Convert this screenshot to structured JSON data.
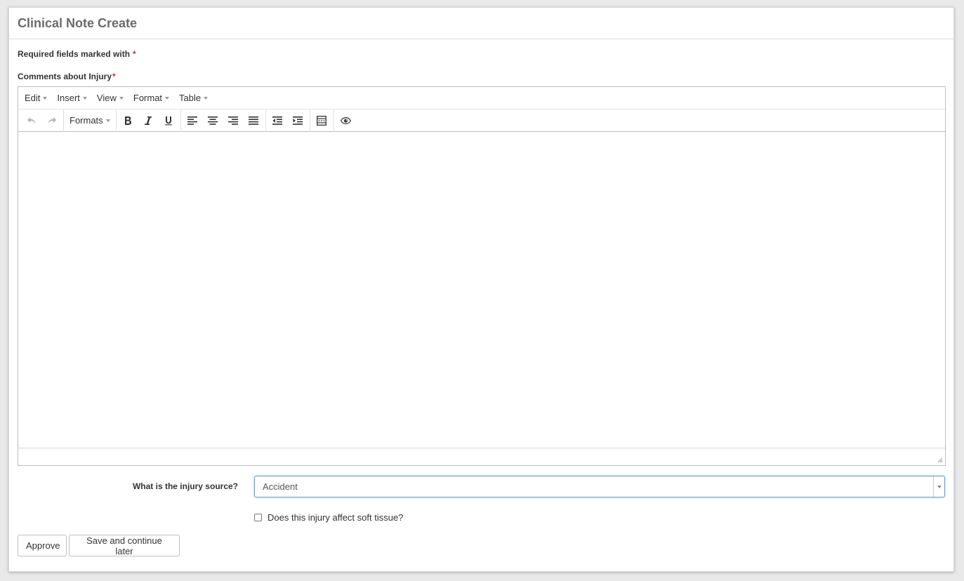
{
  "panel": {
    "title": "Clinical Note Create"
  },
  "form": {
    "required_note": "Required fields marked with",
    "required_marker": "*",
    "comments_label": "Comments about Injury",
    "injury_source_label": "What is the injury source?",
    "injury_source_value": "Accident",
    "soft_tissue_label": "Does this injury affect soft tissue?",
    "soft_tissue_checked": false
  },
  "editor": {
    "menu": [
      "Edit",
      "Insert",
      "View",
      "Format",
      "Table"
    ],
    "formats_label": "Formats",
    "toolbar_icons": [
      "undo-icon",
      "redo-icon",
      "bold-icon",
      "italic-icon",
      "underline-icon",
      "align-left-icon",
      "align-center-icon",
      "align-right-icon",
      "align-justify-icon",
      "outdent-icon",
      "indent-icon",
      "code-sample-icon",
      "preview-eye-icon"
    ],
    "content": ""
  },
  "actions": {
    "approve_label": "Approve",
    "save_later_label": "Save and continue later"
  },
  "colors": {
    "required_star": "#c9302c",
    "focus_border": "#5b9dd9",
    "title_text": "#6b6b6b"
  }
}
